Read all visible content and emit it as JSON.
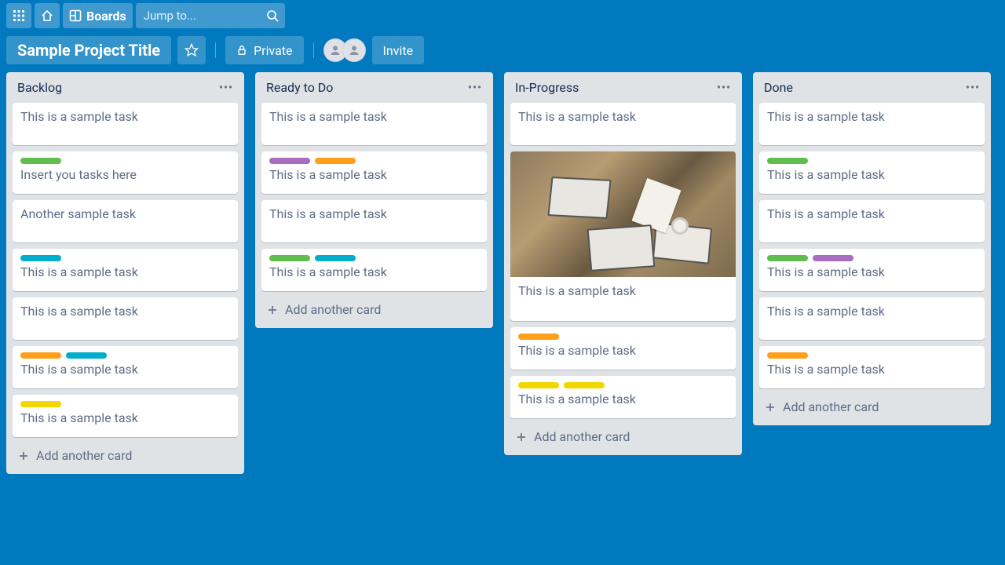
{
  "topbar": {
    "boards_label": "Boards",
    "search_placeholder": "Jump to..."
  },
  "board_header": {
    "title": "Sample Project Title",
    "privacy_label": "Private",
    "invite_label": "Invite"
  },
  "add_card_label": "Add another card",
  "lists": [
    {
      "title": "Backlog",
      "cards": [
        {
          "labels": [],
          "text": "This is a sample task"
        },
        {
          "labels": [
            "green"
          ],
          "text": "Insert you tasks here"
        },
        {
          "labels": [],
          "text": "Another sample task"
        },
        {
          "labels": [
            "blue"
          ],
          "text": "This is a sample task"
        },
        {
          "labels": [],
          "text": "This is a sample task"
        },
        {
          "labels": [
            "orange",
            "blue"
          ],
          "text": "This is a sample task"
        },
        {
          "labels": [
            "yellow"
          ],
          "text": "This is a sample task"
        }
      ]
    },
    {
      "title": "Ready to Do",
      "cards": [
        {
          "labels": [],
          "text": "This is a sample task"
        },
        {
          "labels": [
            "purple",
            "orange"
          ],
          "text": "This is a sample task"
        },
        {
          "labels": [],
          "text": "This is a sample task"
        },
        {
          "labels": [
            "green",
            "blue"
          ],
          "text": "This is a sample task"
        }
      ]
    },
    {
      "title": "In-Progress",
      "cards": [
        {
          "labels": [],
          "text": "This is a sample task"
        },
        {
          "labels": [],
          "text": "This is a sample task",
          "cover": true
        },
        {
          "labels": [
            "orange"
          ],
          "text": "This is a sample task"
        },
        {
          "labels": [
            "yellow",
            "yellow"
          ],
          "text": "This is a sample task"
        }
      ]
    },
    {
      "title": "Done",
      "cards": [
        {
          "labels": [],
          "text": "This is a sample task"
        },
        {
          "labels": [
            "green"
          ],
          "text": "This is a sample task"
        },
        {
          "labels": [],
          "text": "This is a sample task"
        },
        {
          "labels": [
            "green",
            "purple"
          ],
          "text": "This is a sample task"
        },
        {
          "labels": [],
          "text": "This is a sample task"
        },
        {
          "labels": [
            "orange"
          ],
          "text": "This is a sample task"
        }
      ]
    }
  ]
}
